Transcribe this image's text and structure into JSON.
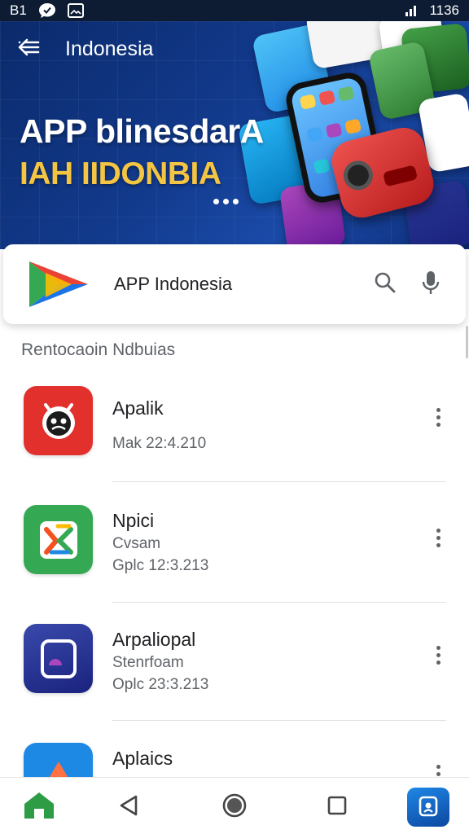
{
  "status_bar": {
    "time_left": "B1",
    "right_text": "1136",
    "icons": [
      "chat-bubble-icon",
      "image-icon",
      "signal-icon"
    ]
  },
  "header": {
    "back_icon": "arrow-left-icon",
    "title": "Indonesia",
    "headline": "APP blinesdarA",
    "subline": "IAH IIDONBIA",
    "carousel_icon": "dots-icon"
  },
  "search": {
    "label": "APP Indonesia",
    "search_icon": "search-icon",
    "mic_icon": "mic-icon"
  },
  "section": {
    "title": "Rentocaoin Ndbuias"
  },
  "apps": [
    {
      "name": "Apalik",
      "line1": "Mak 22:4.210",
      "line2": "",
      "icon_color": "#e2302c"
    },
    {
      "name": "Npici",
      "line1": "Cvsam",
      "line2": "Gplc 12:3.213",
      "icon_color": "#34a853"
    },
    {
      "name": "Arpaliopal",
      "line1": "Stenrfoam",
      "line2": "Oplc 23:3.213",
      "icon_color": "#2a2f8a"
    },
    {
      "name": "Aplaics",
      "line1": "",
      "line2": "",
      "icon_color": "#1e88e5"
    }
  ],
  "bottom_nav": {
    "items": [
      "home-icon",
      "back-triangle-icon",
      "home-circle-icon",
      "recents-square-icon",
      "lock-app-icon"
    ]
  },
  "colors": {
    "hero_blue": "#123a8c",
    "accent_yellow": "#f4c542",
    "home_green": "#2e9b45"
  }
}
